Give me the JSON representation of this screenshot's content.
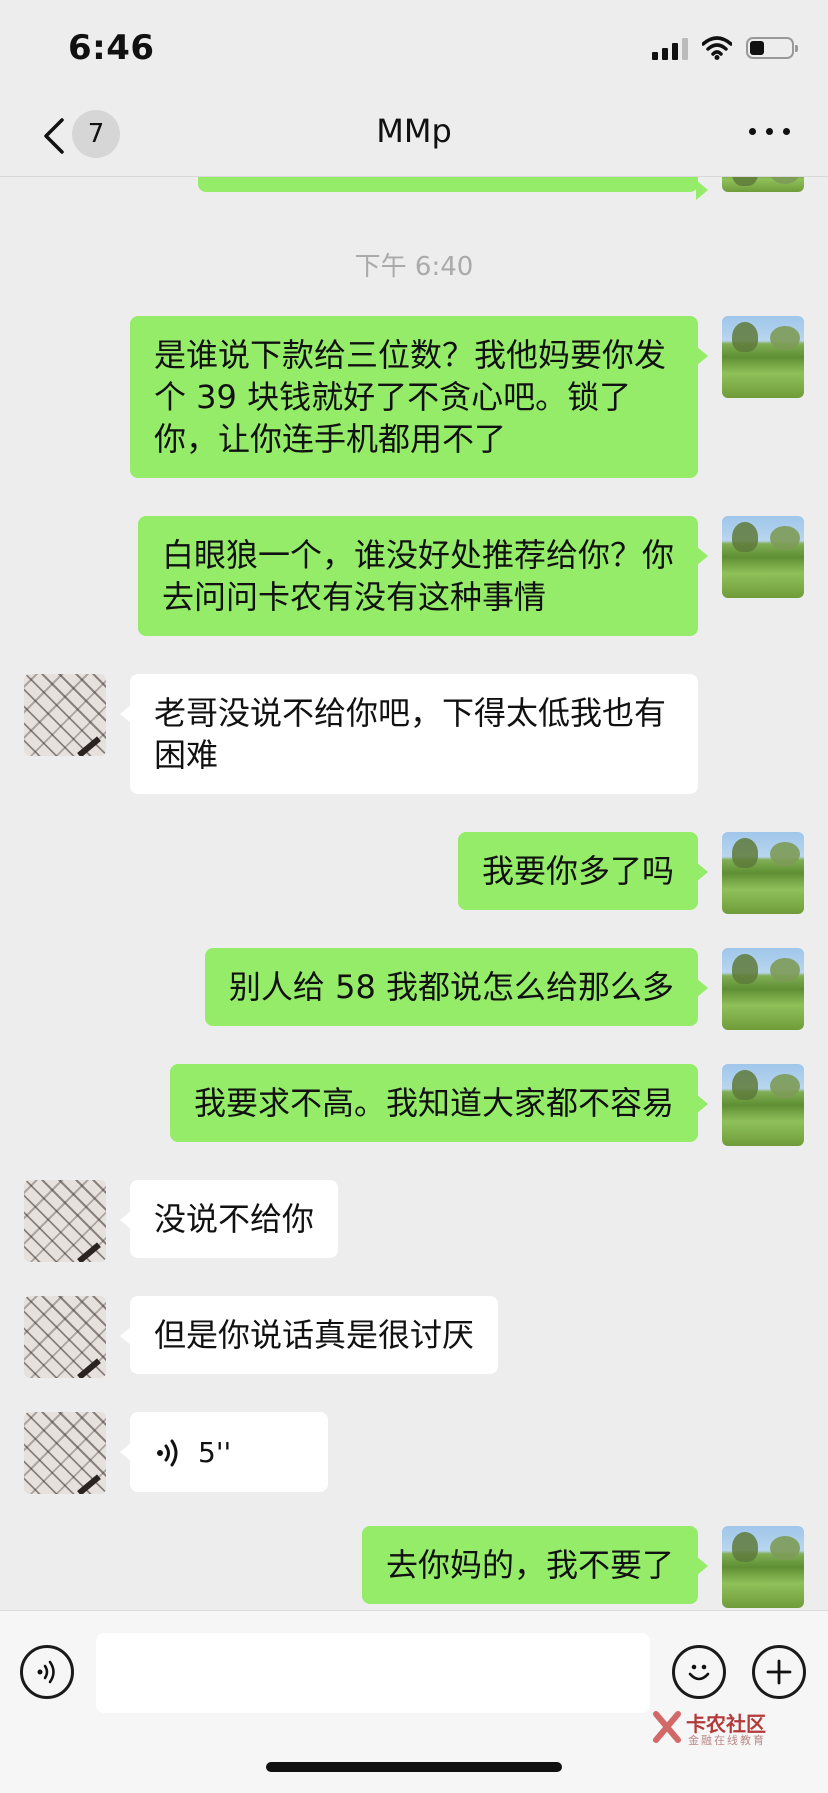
{
  "status_bar": {
    "time": "6:46",
    "battery_level": 0.35
  },
  "nav": {
    "unread_count": "7",
    "title": "MMp"
  },
  "chat": {
    "timestamp": "下午 6:40",
    "messages": [
      {
        "from": "me",
        "text": "是谁说下款给三位数？我他妈要你发个 39 块钱就好了不贪心吧。锁了你，让你连手机都用不了"
      },
      {
        "from": "me",
        "text": "白眼狼一个，谁没好处推荐给你？你去问问卡农有没有这种事情"
      },
      {
        "from": "them",
        "text": "老哥没说不给你吧，下得太低我也有困难"
      },
      {
        "from": "me",
        "text": "我要你多了吗"
      },
      {
        "from": "me",
        "text": "别人给 58 我都说怎么给那么多"
      },
      {
        "from": "me",
        "text": "我要求不高。我知道大家都不容易"
      },
      {
        "from": "them",
        "text": "没说不给你"
      },
      {
        "from": "them",
        "text": "但是你说话真是很讨厌"
      },
      {
        "from": "them",
        "type": "voice",
        "duration": "5''"
      },
      {
        "from": "me",
        "text": "去你妈的，我不要了"
      }
    ]
  },
  "watermark": {
    "brand": "卡农社区",
    "sub": "金融在线教育"
  }
}
